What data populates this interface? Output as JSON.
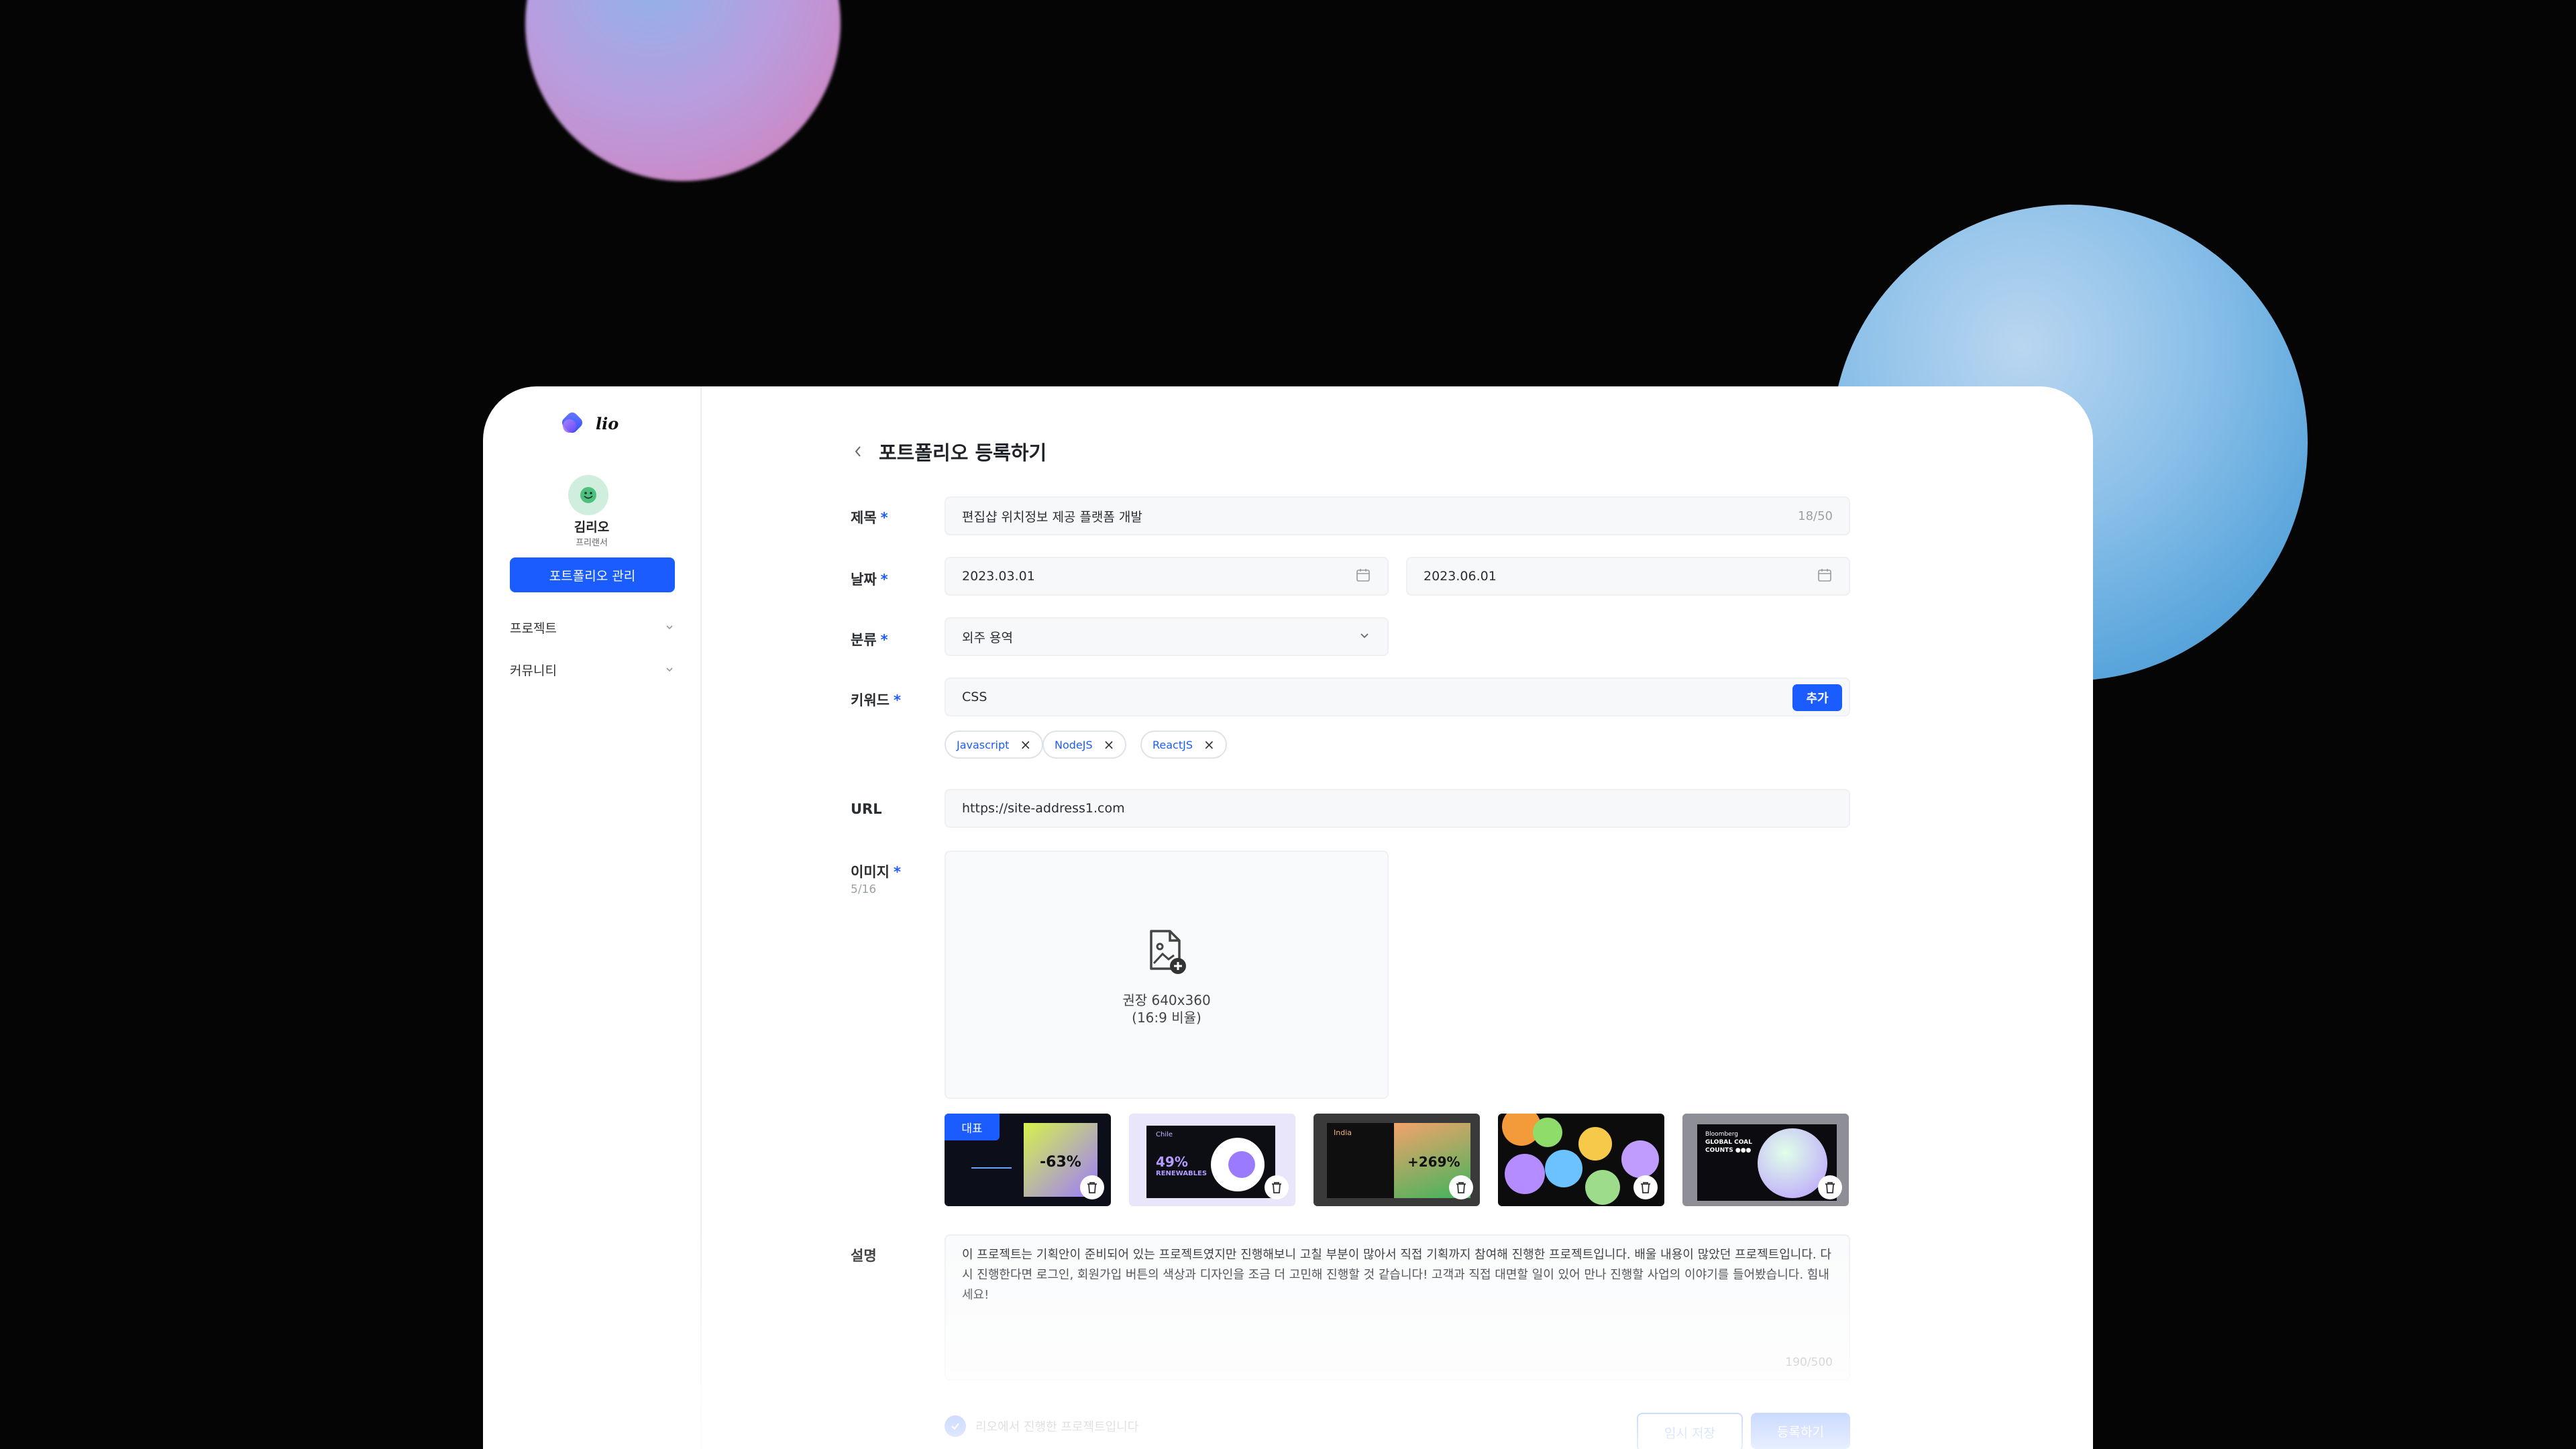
{
  "app": {
    "logo_text": "lio"
  },
  "profile": {
    "name": "김리오",
    "role": "프리랜서"
  },
  "sidebar": {
    "manage_button": "포트폴리오 관리",
    "items": [
      {
        "label": "프로젝트"
      },
      {
        "label": "커뮤니티"
      }
    ]
  },
  "page": {
    "title": "포트폴리오 등록하기"
  },
  "form": {
    "title": {
      "label": "제목",
      "value": "편집샵 위치정보 제공 플랫폼 개발",
      "count": "18/50"
    },
    "date": {
      "label": "날짜",
      "start": "2023.03.01",
      "end": "2023.06.01"
    },
    "category": {
      "label": "분류",
      "value": "외주 용역"
    },
    "keyword": {
      "label": "키워드",
      "value": "CSS",
      "add_button": "추가",
      "tags": [
        "Javascript",
        "NodeJS",
        "ReactJS"
      ]
    },
    "url": {
      "label": "URL",
      "value": "https://site-address1.com"
    },
    "image": {
      "label": "이미지",
      "count": "5/16",
      "upload_hint_1": "권장 640x360",
      "upload_hint_2": "(16:9 비율)",
      "representative_badge": "대표",
      "thumbs": [
        {
          "caption": "-63%"
        },
        {
          "caption": "49%",
          "caption2": "RENEWABLES",
          "heading": "Chile"
        },
        {
          "caption": "+269%",
          "heading": "India"
        },
        {
          "caption": ""
        },
        {
          "caption": "",
          "heading": "Bloomberg",
          "heading2": "GLOBAL COAL",
          "heading3": "COUNTS ●●●"
        }
      ]
    },
    "description": {
      "label": "설명",
      "value": "이 프로젝트는 기획안이 준비되어 있는 프로젝트였지만 진행해보니 고칠 부분이 많아서 직접 기획까지 참여해 진행한 프로젝트입니다. 배울 내용이 많았던 프로젝트입니다. 다시 진행한다면 로그인, 회원가입 버튼의 색상과 디자인을 조금 더 고민해 진행할 것 같습니다! 고객과 직접 대면할 일이 있어 만나 진행할 사업의 이야기를 들어봤습니다. 힘내세요!",
      "count": "190/500"
    },
    "footer": {
      "checkbox_label": "리오에서 진행한 프로젝트입니다",
      "temp_save": "임시 저장",
      "submit": "등록하기"
    }
  },
  "colors": {
    "accent": "#1a5cff",
    "background": "#050505"
  }
}
